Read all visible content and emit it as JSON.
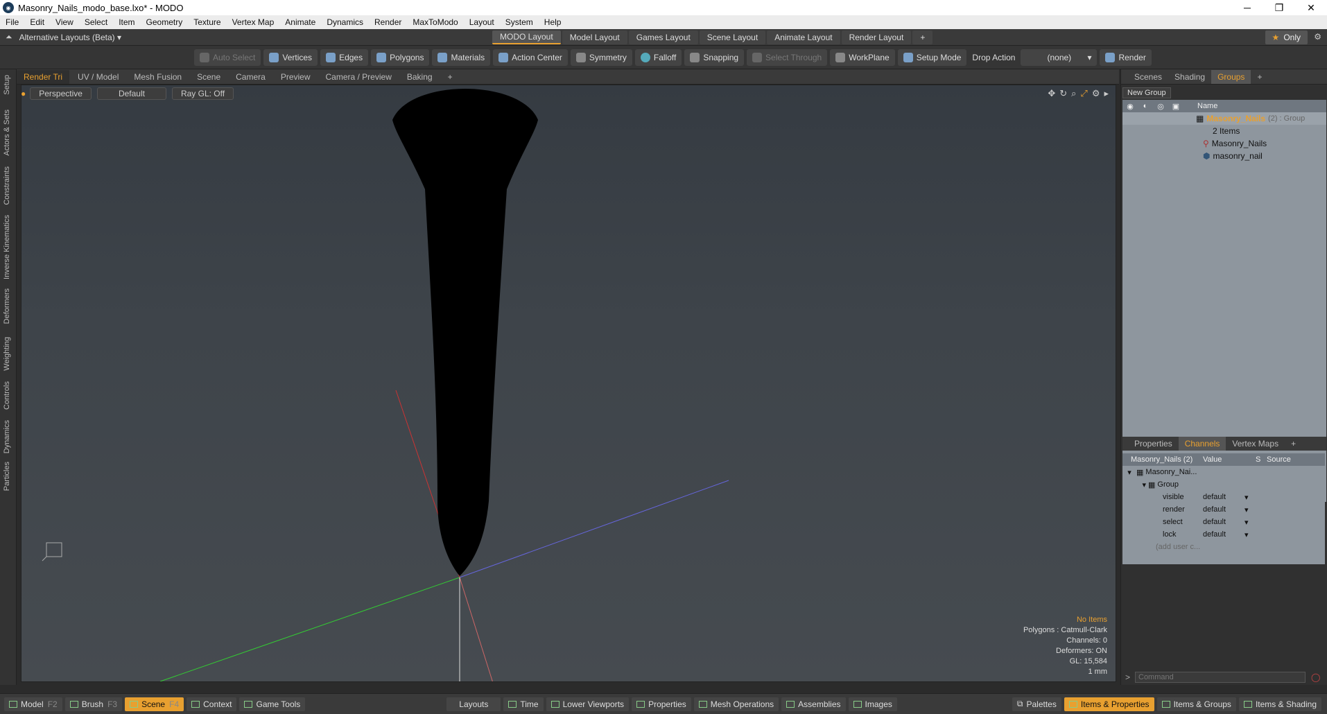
{
  "window": {
    "title": "Masonry_Nails_modo_base.lxo* - MODO",
    "app_icon": "modo-logo-icon"
  },
  "menu": [
    "File",
    "Edit",
    "View",
    "Select",
    "Item",
    "Geometry",
    "Texture",
    "Vertex Map",
    "Animate",
    "Dynamics",
    "Render",
    "MaxToModo",
    "Layout",
    "System",
    "Help"
  ],
  "layout_bar": {
    "alt_label": "Alternative Layouts (Beta) ▾",
    "tabs": [
      "MODO Layout",
      "Model Layout",
      "Games Layout",
      "Scene Layout",
      "Animate Layout",
      "Render Layout"
    ],
    "active_tab": "MODO Layout",
    "only_label": "Only"
  },
  "toolbar": {
    "auto_select": "Auto Select",
    "vertices": "Vertices",
    "edges": "Edges",
    "polygons": "Polygons",
    "materials": "Materials",
    "action_center": "Action Center",
    "symmetry": "Symmetry",
    "falloff": "Falloff",
    "snapping": "Snapping",
    "select_through": "Select Through",
    "workplane": "WorkPlane",
    "setup_mode": "Setup Mode",
    "drop_action": "Drop Action",
    "drop_value": "(none)",
    "render": "Render"
  },
  "left_strip": [
    "Setup",
    "Actors & Sets",
    "Constraints",
    "Inverse Kinematics",
    "Deformers",
    "Weighting",
    "Controls",
    "Dynamics",
    "Particles"
  ],
  "viewport_tabs": [
    "Render Tri",
    "UV / Model",
    "Mesh Fusion",
    "Scene",
    "Camera",
    "Preview",
    "Camera / Preview",
    "Baking"
  ],
  "viewport_opts": {
    "perspective": "Perspective",
    "shading": "Default",
    "raygl": "Ray GL: Off"
  },
  "hud": {
    "items": "No Items",
    "polygons": "Polygons : Catmull-Clark",
    "channels": "Channels: 0",
    "deformers": "Deformers: ON",
    "gl": "GL: 15,584",
    "unit": "1 mm"
  },
  "right_tabs": [
    "Scenes",
    "Shading",
    "Groups"
  ],
  "groups": {
    "new_group": "New Group",
    "name_header": "Name",
    "group_name": "Masonry_Nails",
    "group_suffix": "(2) : Group",
    "items_count": "2 Items",
    "children": [
      "Masonry_Nails",
      "masonry_nail"
    ]
  },
  "channel_tabs": [
    "Properties",
    "Channels",
    "Vertex Maps"
  ],
  "channels": {
    "header_name": "Masonry_Nails (2)",
    "header_value": "Value",
    "header_s": "S",
    "header_source": "Source",
    "item": "Masonry_Nai...",
    "group": "Group",
    "rows": [
      {
        "name": "visible",
        "value": "default"
      },
      {
        "name": "render",
        "value": "default"
      },
      {
        "name": "select",
        "value": "default"
      },
      {
        "name": "lock",
        "value": "default"
      }
    ],
    "add_user": "(add user c..."
  },
  "command_placeholder": "Command",
  "status_left": [
    {
      "label": "Model",
      "key": "F2"
    },
    {
      "label": "Brush",
      "key": "F3"
    },
    {
      "label": "Scene",
      "key": "F4"
    },
    {
      "label": "Context",
      "key": ""
    },
    {
      "label": "Game Tools",
      "key": ""
    }
  ],
  "status_mid": [
    "Layouts",
    "Time",
    "Lower Viewports",
    "Properties",
    "Mesh Operations",
    "Assemblies",
    "Images"
  ],
  "status_right": [
    "Palettes",
    "Items & Properties",
    "Items & Groups",
    "Items & Shading"
  ],
  "colors": {
    "accent": "#e8a030",
    "x_axis": "#cc3333",
    "y_axis": "#33cc33",
    "z_axis": "#6666dd"
  }
}
